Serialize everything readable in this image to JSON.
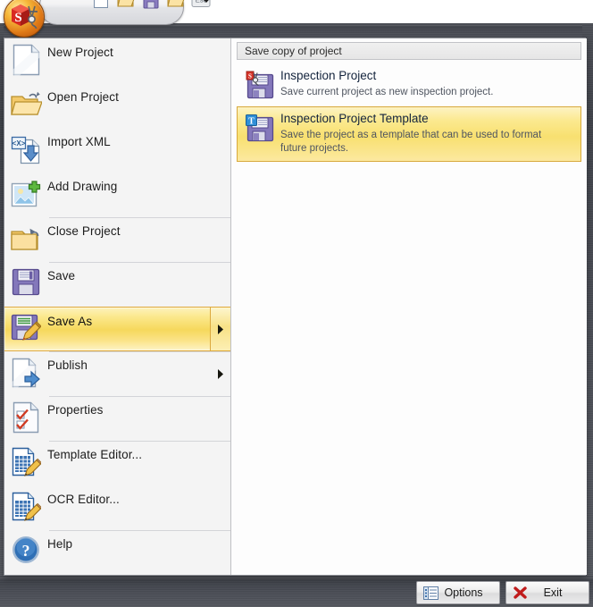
{
  "app": {
    "logo_icon": "app-orb-logo-icon"
  },
  "quick_access_toolbar": {
    "buttons": [
      {
        "name": "new-document",
        "icon": "new-document-icon"
      },
      {
        "name": "open-folder",
        "icon": "open-folder-icon"
      },
      {
        "name": "save",
        "icon": "save-floppy-icon"
      },
      {
        "name": "close-project",
        "icon": "folder-close-arrow-icon"
      },
      {
        "name": "escape",
        "icon": "escape-key-icon",
        "label": "Esc"
      }
    ],
    "overflow_icon": "chevron-down-icon"
  },
  "menu": {
    "items": [
      {
        "label": "New Project",
        "icon": "new-document-icon",
        "separator_above": false,
        "has_submenu": false,
        "selected": false
      },
      {
        "label": "Open Project",
        "icon": "open-folder-icon",
        "separator_above": false,
        "has_submenu": false,
        "selected": false
      },
      {
        "label": "Import XML",
        "icon": "import-xml-icon",
        "separator_above": false,
        "has_submenu": false,
        "selected": false
      },
      {
        "label": "Add Drawing",
        "icon": "add-drawing-icon",
        "separator_above": false,
        "has_submenu": false,
        "selected": false
      },
      {
        "label": "Close Project",
        "icon": "close-project-icon",
        "separator_above": true,
        "has_submenu": false,
        "selected": false
      },
      {
        "label": "Save",
        "icon": "save-floppy-icon",
        "separator_above": true,
        "has_submenu": false,
        "selected": false
      },
      {
        "label": "Save As",
        "icon": "save-as-icon",
        "separator_above": false,
        "has_submenu": true,
        "selected": true
      },
      {
        "label": "Publish",
        "icon": "publish-icon",
        "separator_above": true,
        "has_submenu": true,
        "selected": false
      },
      {
        "label": "Properties",
        "icon": "properties-icon",
        "separator_above": true,
        "has_submenu": false,
        "selected": false
      },
      {
        "label": "Template Editor...",
        "icon": "template-editor-icon",
        "separator_above": true,
        "has_submenu": false,
        "selected": false
      },
      {
        "label": "OCR Editor...",
        "icon": "ocr-editor-icon",
        "separator_above": false,
        "has_submenu": false,
        "selected": false
      },
      {
        "label": "Help",
        "icon": "help-icon",
        "separator_above": true,
        "has_submenu": false,
        "selected": false
      }
    ]
  },
  "submenu": {
    "header": "Save copy of project",
    "items": [
      {
        "title": "Inspection Project",
        "description": "Save current project as new inspection project.",
        "icon": "save-inspection-project-icon",
        "selected": false
      },
      {
        "title": "Inspection Project Template",
        "description": "Save the project as a template that can be used to format future projects.",
        "icon": "save-template-icon",
        "selected": true
      }
    ]
  },
  "footer": {
    "options_label": "Options",
    "options_icon": "options-list-icon",
    "exit_label": "Exit",
    "exit_icon": "close-x-icon"
  },
  "colors": {
    "highlight_gold": "#f6d85c",
    "highlight_border": "#dfa93b",
    "panel_background": "#f4f4f4",
    "chrome_dark": "#4a4d55",
    "exit_red": "#c01c1c",
    "floppy_purple": "#7b6fb5"
  }
}
